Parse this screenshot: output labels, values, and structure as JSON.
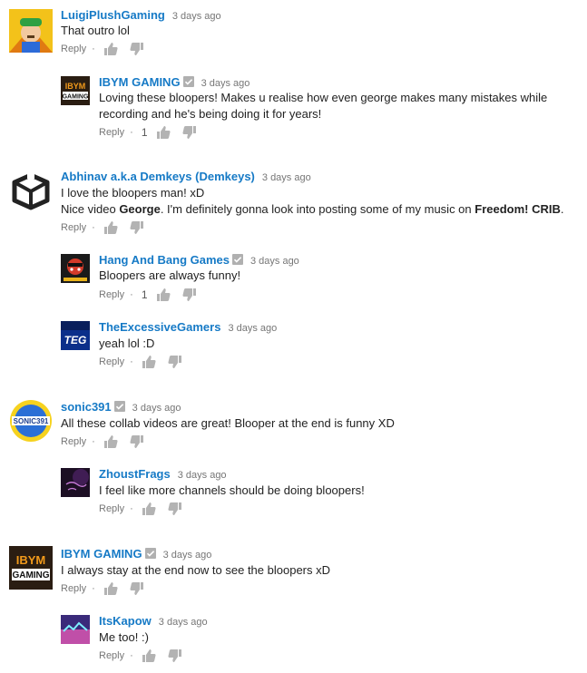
{
  "comments": [
    {
      "author": "LuigiPlushGaming",
      "time": "3 days ago",
      "text": "That outro lol",
      "reply_label": "Reply",
      "likes": ""
    },
    {
      "author": "IBYM GAMING",
      "time": "3 days ago",
      "text_line1": "Loving these bloopers! Makes u realise how even george makes many mistakes while",
      "text_line2": "recording and he's being doing it for years!",
      "reply_label": "Reply",
      "likes": "1"
    },
    {
      "author": "Abhinav a.k.a Demkeys (Demkeys)",
      "time": "3 days ago",
      "text_line1": "I love the bloopers man! xD",
      "text_line2_a": "Nice video ",
      "text_line2_b": "George",
      "text_line2_c": ". I'm definitely gonna look into posting some of my music on ",
      "text_line2_d": "Freedom! CRIB",
      "text_line2_e": ".",
      "reply_label": "Reply",
      "likes": ""
    },
    {
      "author": "Hang And Bang Games",
      "time": "3 days ago",
      "text": "Bloopers are always funny!",
      "reply_label": "Reply",
      "likes": "1"
    },
    {
      "author": "TheExcessiveGamers",
      "time": "3 days ago",
      "text": "yeah lol :D",
      "reply_label": "Reply",
      "likes": ""
    },
    {
      "author": "sonic391",
      "time": "3 days ago",
      "text": "All these collab videos are great! Blooper at the end is funny XD",
      "reply_label": "Reply",
      "likes": ""
    },
    {
      "author": "ZhoustFrags",
      "time": "3 days ago",
      "text": "I feel like more channels should be doing bloopers!",
      "reply_label": "Reply",
      "likes": ""
    },
    {
      "author": "IBYM GAMING",
      "time": "3 days ago",
      "text": "I always stay at the end now to see the bloopers xD",
      "reply_label": "Reply",
      "likes": ""
    },
    {
      "author": "ItsKapow",
      "time": "3 days ago",
      "text": "Me too! :)",
      "reply_label": "Reply",
      "likes": ""
    }
  ],
  "avatar_text": {
    "ibym": "IBYM",
    "ibym_sub": "GAMING",
    "teg": "TEG",
    "sonic": "SONIC391"
  },
  "colors": {
    "author": "#167ac6",
    "time": "#767676",
    "text": "#222222"
  }
}
